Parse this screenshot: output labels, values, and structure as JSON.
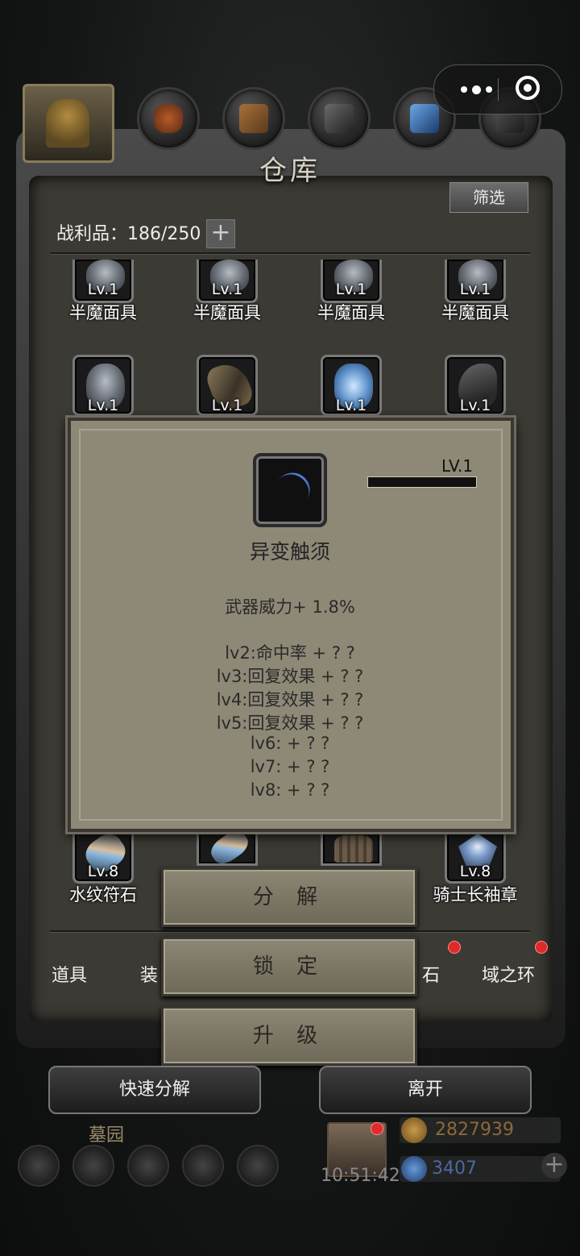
{
  "window": {
    "title": "仓库"
  },
  "capsule": {
    "more_label": "",
    "close_label": ""
  },
  "header": {
    "filter_label": "筛选",
    "loot_label": "战利品：186/250",
    "expand_label": "+"
  },
  "grid": {
    "row1": [
      {
        "level": "Lv.1",
        "name": "半魔面具",
        "icon": "mask-icon"
      },
      {
        "level": "Lv.1",
        "name": "半魔面具",
        "icon": "mask-icon"
      },
      {
        "level": "Lv.1",
        "name": "半魔面具",
        "icon": "mask-icon"
      },
      {
        "level": "Lv.1",
        "name": "半魔面具",
        "icon": "mask-icon"
      }
    ],
    "row2": [
      {
        "level": "Lv.1",
        "icon": "mask-icon"
      },
      {
        "level": "Lv.1",
        "icon": "tooth-icon"
      },
      {
        "level": "Lv.1",
        "icon": "ice-crystal-icon"
      },
      {
        "level": "Lv.1",
        "icon": "claw-icon"
      }
    ],
    "row_last": [
      {
        "level": "Lv.8",
        "name": "水纹符石",
        "icon": "rune-stone-icon"
      },
      {
        "level": "",
        "icon": "rune-stone-icon"
      },
      {
        "level": "",
        "icon": "shell-icon"
      },
      {
        "level": "Lv.8",
        "name": "骑士长袖章",
        "icon": "armband-icon"
      }
    ]
  },
  "tabs": [
    {
      "label": "道具"
    },
    {
      "label": "装"
    },
    {
      "label": "石"
    },
    {
      "label": "域之环"
    }
  ],
  "popup": {
    "level": "LV.1",
    "name": "异变触须",
    "icon": "tentacle-icon",
    "main_stat": "武器威力+ 1.8%",
    "stats": [
      "lv2:命中率 + ? ?",
      "lv3:回复效果 + ? ?",
      "lv4:回复效果 + ? ?",
      "lv5:回复效果 + ? ?",
      "lv6: + ? ?",
      "lv7: + ? ?",
      "lv8: + ? ?"
    ]
  },
  "actions": {
    "decompose": "分 解",
    "lock": "锁 定",
    "upgrade": "升 级"
  },
  "footer": {
    "quick_decompose": "快速分解",
    "leave": "离开"
  },
  "hud": {
    "location": "墓园",
    "clock": "10:51:42",
    "gold": "2827939",
    "gems": "3407",
    "add_label": "+"
  },
  "colors": {
    "popup_bg": "#8e8876",
    "button_bg": "#7e7866",
    "red_dot": "#e02a2a"
  }
}
